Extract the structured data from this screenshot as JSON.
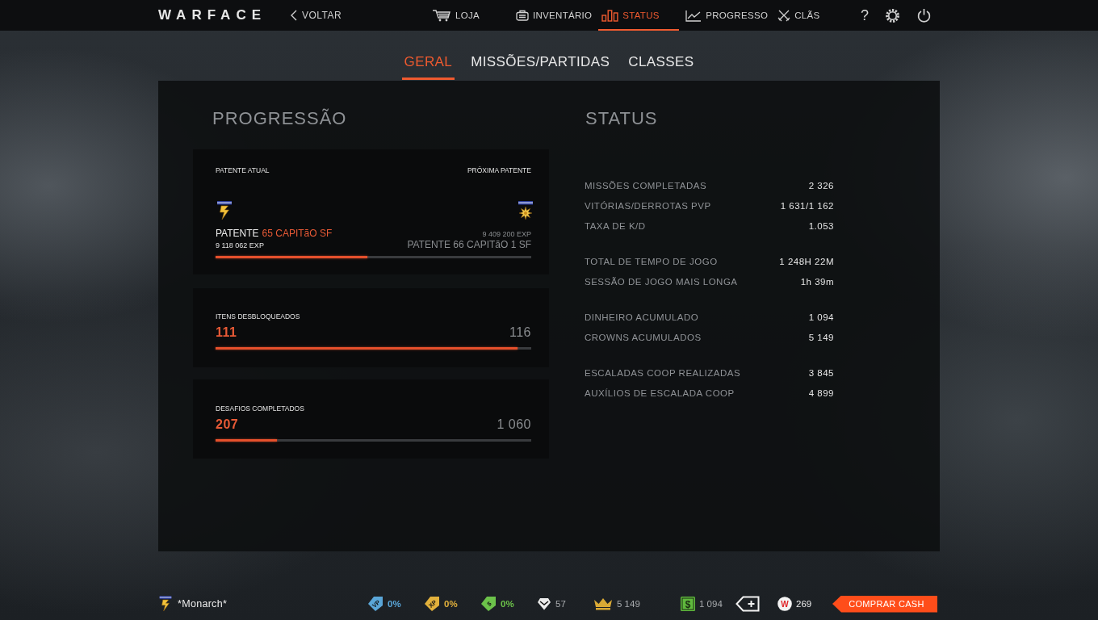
{
  "top_bar": {
    "logo": "WARFACE",
    "back": "VOLTAR",
    "nav": [
      {
        "label": "LOJA",
        "selected": false
      },
      {
        "label": "INVENTÁRIO",
        "selected": false
      },
      {
        "label": "STATUS",
        "selected": true
      },
      {
        "label": "PROGRESSO",
        "selected": false
      },
      {
        "label": "CLÃS",
        "selected": false
      }
    ],
    "help": "?"
  },
  "tabs": [
    {
      "label": "GERAL",
      "selected": true
    },
    {
      "label": "MISSÕES/PARTIDAS",
      "selected": false
    },
    {
      "label": "CLASSES",
      "selected": false
    }
  ],
  "progression": {
    "title": "PROGRESSÃO",
    "rank": {
      "current_label": "PATENTE ATUAL",
      "next_label": "PRÓXIMA PATENTE",
      "current_prefix": "PATENTE",
      "current_name": "65 CAPITãO SF",
      "current_exp": "9 118 062 EXP",
      "next_exp": "9 409 200 EXP",
      "next_rank": "PATENTE 66 CAPITãO 1 SF",
      "level": 0.48
    },
    "counters": [
      {
        "label": "ITENS DESBLOQUEADOS",
        "value": "111",
        "total": "116",
        "level": 0.957
      },
      {
        "label": "DESAFIOS COMPLETADOS",
        "value": "207",
        "total": "1 060",
        "level": 0.195
      }
    ]
  },
  "status": {
    "title": "STATUS",
    "groups": [
      {
        "rows": [
          {
            "label": "MISSÕES COMPLETADAS",
            "value": "2 326"
          },
          {
            "label": "VITÓRIAS/DERROTAS PVP",
            "value": "1 631/1 162"
          },
          {
            "label": "TAXA DE K/D",
            "value": "1.053"
          }
        ]
      },
      {
        "rows": [
          {
            "label": "TOTAL DE TEMPO DE JOGO",
            "value": "1 248H 22M"
          },
          {
            "label": "SESSÃO DE JOGO MAIS LONGA",
            "value": "1h 39m"
          }
        ]
      },
      {
        "rows": [
          {
            "label": "DINHEIRO ACUMULADO",
            "value": "1 094"
          },
          {
            "label": "CROWNS ACUMULADOS",
            "value": "5 149"
          }
        ]
      },
      {
        "rows": [
          {
            "label": "ESCALADAS COOP REALIZADAS",
            "value": "3 845"
          },
          {
            "label": "AUXÍLIOS DE ESCALADA COOP",
            "value": "4 899"
          }
        ]
      }
    ]
  },
  "bottom_bar": {
    "player_name": "*Monarch*",
    "boosters": [
      {
        "tag": "VP",
        "value": "0%",
        "color": "#5aa6d8"
      },
      {
        "tag": "XP",
        "value": "0%",
        "color": "#e2b13c"
      },
      {
        "tag": "$",
        "value": "0%",
        "color": "#6cc24a"
      }
    ],
    "resources": [
      {
        "value": "57"
      },
      {
        "value": "5 149"
      }
    ],
    "money": {
      "symbol": "$",
      "value": "1 094"
    },
    "cash": {
      "symbol": "W",
      "value": "269"
    },
    "buy_button": "COMPRAR CASH"
  }
}
